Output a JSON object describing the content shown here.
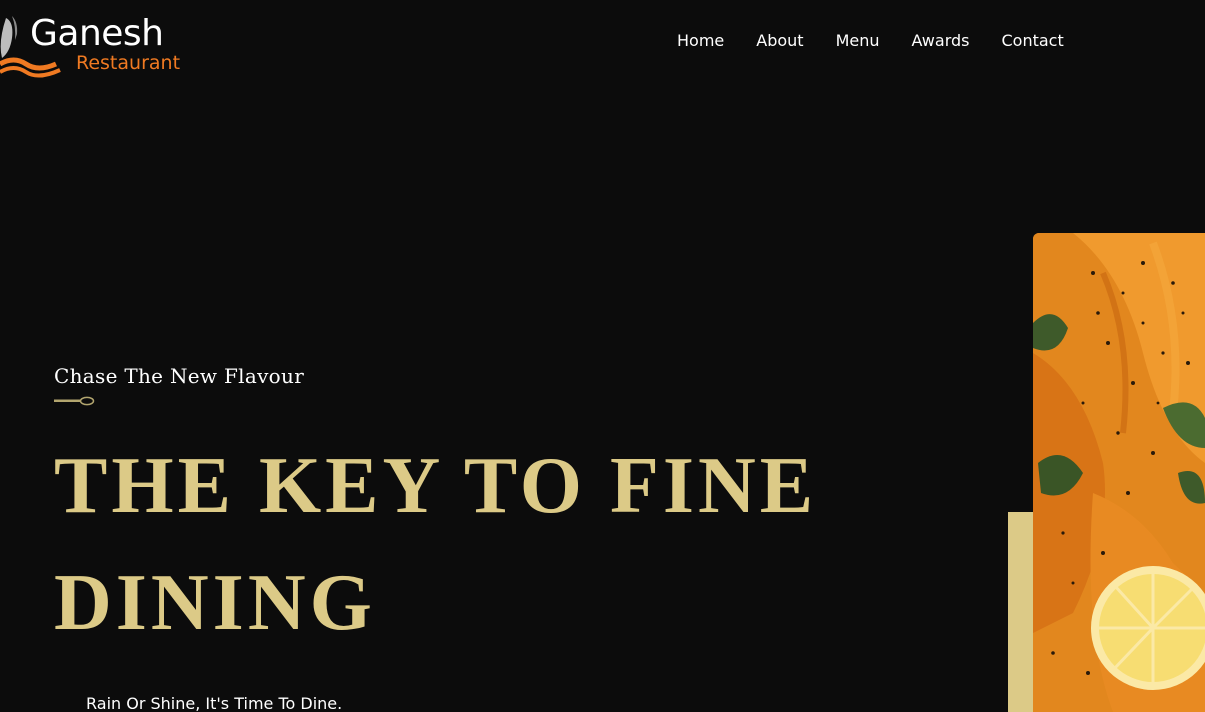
{
  "brand": {
    "name": "Ganesh",
    "subtitle": "Restaurant",
    "accent_color": "#f07a22",
    "gold_color": "#dcca87"
  },
  "nav": {
    "items": [
      {
        "label": "Home"
      },
      {
        "label": "About"
      },
      {
        "label": "Menu"
      },
      {
        "label": "Awards"
      },
      {
        "label": "Contact"
      }
    ]
  },
  "hero": {
    "eyebrow": "Chase The New Flavour",
    "title": "THE KEY TO FINE DINING",
    "tagline": "Rain Or Shine, It's Time To Dine.",
    "divider_icon": "spoon-icon",
    "image_icon": "food-dish-photo"
  }
}
